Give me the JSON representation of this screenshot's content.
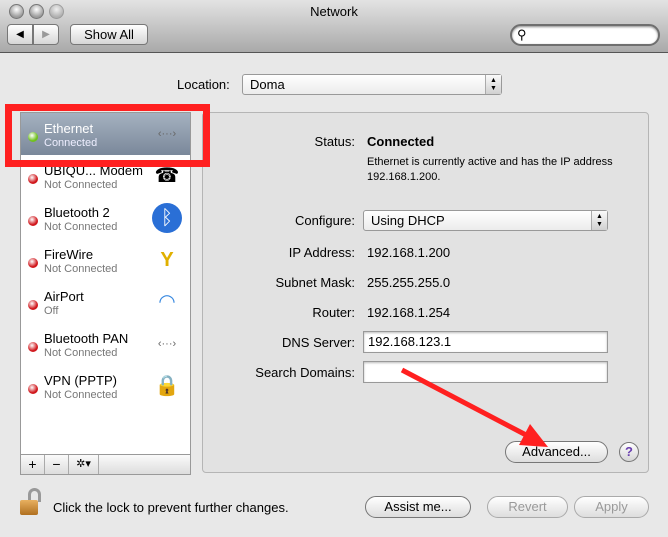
{
  "window": {
    "title": "Network"
  },
  "toolbar": {
    "back": "◀",
    "forward": "▶",
    "show_all": "Show All",
    "search_placeholder": ""
  },
  "location": {
    "label": "Location:",
    "value": "Doma"
  },
  "services": [
    {
      "name": "Ethernet",
      "status": "Connected",
      "dot": "#6fc21b",
      "icon": "ethernet-icon",
      "glyph": "‹···›"
    },
    {
      "name": "UBIQU... Modem",
      "status": "Not Connected",
      "dot": "#d0161b",
      "icon": "phone-icon",
      "glyph": "☎"
    },
    {
      "name": "Bluetooth 2",
      "status": "Not Connected",
      "dot": "#d0161b",
      "icon": "bluetooth-icon",
      "glyph": "ᛒ"
    },
    {
      "name": "FireWire",
      "status": "Not Connected",
      "dot": "#d0161b",
      "icon": "firewire-icon",
      "glyph": "Y"
    },
    {
      "name": "AirPort",
      "status": "Off",
      "dot": "#d0161b",
      "icon": "wifi-icon",
      "glyph": "◠"
    },
    {
      "name": "Bluetooth PAN",
      "status": "Not Connected",
      "dot": "#d0161b",
      "icon": "ethernet-icon",
      "glyph": "‹···›"
    },
    {
      "name": "VPN (PPTP)",
      "status": "Not Connected",
      "dot": "#d0161b",
      "icon": "lock-icon",
      "glyph": "🔒"
    }
  ],
  "sidebar_buttons": {
    "add": "+",
    "remove": "−",
    "gear": "✲▾"
  },
  "detail": {
    "status_label": "Status:",
    "status_value": "Connected",
    "status_desc": "Ethernet is currently active and has the IP address 192.168.1.200.",
    "configure_label": "Configure:",
    "configure_value": "Using DHCP",
    "ip_label": "IP Address:",
    "ip_value": "192.168.1.200",
    "subnet_label": "Subnet Mask:",
    "subnet_value": "255.255.255.0",
    "router_label": "Router:",
    "router_value": "192.168.1.254",
    "dns_label": "DNS Server:",
    "dns_value": "192.168.123.1",
    "search_label": "Search Domains:",
    "search_value": "",
    "advanced": "Advanced...",
    "help": "?"
  },
  "footer": {
    "lock_text": "Click the lock to prevent further changes.",
    "assist": "Assist me...",
    "revert": "Revert",
    "apply": "Apply"
  },
  "annotation": {
    "color": "#ff2020"
  }
}
